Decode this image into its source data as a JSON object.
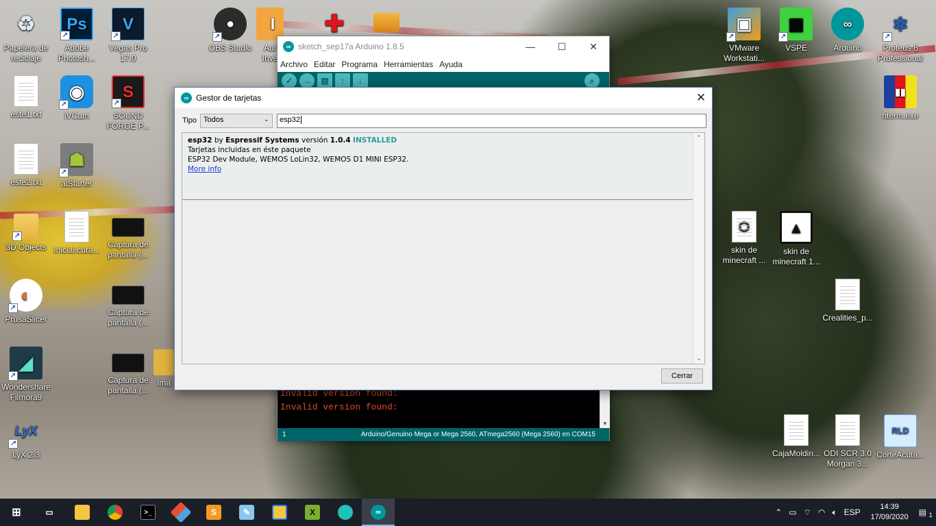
{
  "desktop_icons": [
    {
      "label": "Papelera de reciclaje",
      "icon": "recycle-bin-icon"
    },
    {
      "label": "Adobe Photosh...",
      "icon": "photoshop-icon",
      "glyph": "Ps"
    },
    {
      "label": "Vegas Pro 17.0",
      "icon": "vegas-pro-icon",
      "glyph": "V"
    },
    {
      "label": "OBS Studio",
      "icon": "obs-icon"
    },
    {
      "label": "Aut Inve",
      "icon": "autodesk-inventor-icon",
      "glyph": "I"
    },
    {
      "label": "este1.txt",
      "icon": "text-file-icon"
    },
    {
      "label": "iVCam",
      "icon": "ivcam-icon"
    },
    {
      "label": "SOUND FORGE P...",
      "icon": "sound-forge-icon",
      "glyph": "S"
    },
    {
      "label": "este2.txt",
      "icon": "text-file-icon"
    },
    {
      "label": "aiStarter",
      "icon": "android-icon"
    },
    {
      "label": "3D Objects",
      "icon": "folder-icon"
    },
    {
      "label": "Inicial.cura...",
      "icon": "file-icon"
    },
    {
      "label": "Captura de pantalla (...",
      "icon": "screenshot-icon"
    },
    {
      "label": "PrusaSlicer",
      "icon": "prusaslicer-icon"
    },
    {
      "label": "Captura de pantalla (...",
      "icon": "screenshot-icon"
    },
    {
      "label": "Wondershare Filmora9",
      "icon": "filmora-icon"
    },
    {
      "label": "Captura de pantalla (...",
      "icon": "screenshot-icon"
    },
    {
      "label": "Ima",
      "icon": "folder-icon"
    },
    {
      "label": "LyX 2.3",
      "icon": "lyx-icon",
      "glyph": "LyX"
    },
    {
      "label": "VMware Workstati...",
      "icon": "vmware-icon"
    },
    {
      "label": "VSPE",
      "icon": "vspe-icon"
    },
    {
      "label": "Arduino",
      "icon": "arduino-icon"
    },
    {
      "label": "Proteus 8 Professional",
      "icon": "proteus-icon"
    },
    {
      "label": "hterm.exe",
      "icon": "hterm-icon"
    },
    {
      "label": "skin de minecraft ...",
      "icon": "3d-file-icon"
    },
    {
      "label": "skin de minecraft 1...",
      "icon": "image-file-icon"
    },
    {
      "label": "Crealities_p...",
      "icon": "file-icon"
    },
    {
      "label": "CajaMoldin...",
      "icon": "file-icon"
    },
    {
      "label": "ODI SCR 3.0 Morgan 3...",
      "icon": "file-icon"
    },
    {
      "label": "CorteAcuta...",
      "icon": "rld-file-icon",
      "glyph": "RLD"
    }
  ],
  "arduino": {
    "title": "sketch_sep17a Arduino 1.8.5",
    "menu": [
      "Archivo",
      "Editar",
      "Programa",
      "Herramientas",
      "Ayuda"
    ],
    "console_lines": [
      "Invalid version found:",
      "Invalid version found:"
    ],
    "status_line": "1",
    "status_board": "Arduino/Genuino Mega or Mega 2560, ATmega2560 (Mega 2560) en COM15"
  },
  "dialog": {
    "title": "Gestor de tarjetas",
    "filter_label": "Tipo",
    "filter_value": "Todos",
    "search_value": "esp32",
    "entry": {
      "name": "esp32",
      "by": "by",
      "author": "Espressif Systems",
      "version_label": "versión",
      "version": "1.0.4",
      "status": "INSTALLED",
      "boards_heading": "Tarjetas incluidas en éste paquete",
      "boards": "ESP32 Dev Module, WEMOS LoLin32, WEMOS D1 MINI ESP32.",
      "more_info": "More info"
    },
    "close_label": "Cerrar"
  },
  "taskbar": {
    "apps": [
      "start",
      "task-view",
      "file-explorer",
      "chrome",
      "terminal",
      "git",
      "sublime",
      "notepad",
      "file-manager",
      "xilinx",
      "browser",
      "arduino"
    ],
    "language": "ESP",
    "time": "14:39",
    "date": "17/09/2020",
    "notifications": "1"
  },
  "colors": {
    "arduino_teal": "#00979c",
    "arduino_dark": "#006468",
    "installed": "#2a9aa0",
    "link": "#1a3fcc",
    "console_error": "#e34c26"
  }
}
